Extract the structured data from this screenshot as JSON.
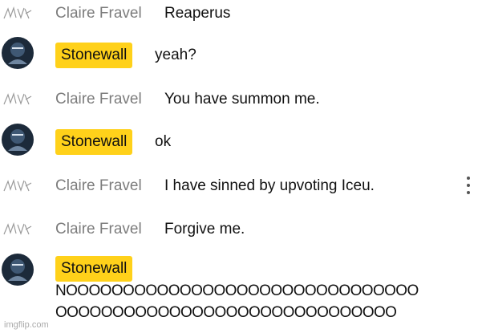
{
  "chat": {
    "messages": [
      {
        "author": "Claire Fravel",
        "text": "Reaperus"
      },
      {
        "author": "Stonewall",
        "text": "yeah?"
      },
      {
        "author": "Claire Fravel",
        "text": "You have summon me."
      },
      {
        "author": "Stonewall",
        "text": "ok"
      },
      {
        "author": "Claire Fravel",
        "text": "I have sinned by upvoting Iceu."
      },
      {
        "author": "Claire Fravel",
        "text": "Forgive me."
      },
      {
        "author": "Stonewall",
        "text_line1": "NOOOOOOOOOOOOOOOOOOOOOOOOOOOOOOO",
        "text_line2": "OOOOOOOOOOOOOOOOOOOOOOOOOOOOOO"
      }
    ]
  },
  "watermark": "imgflip.com",
  "colors": {
    "badge": "#ffd11a",
    "author_gray": "#7c7c7c",
    "avatar_dark": "#1c2a3a"
  },
  "icons": {
    "claire_avatar": "scribble-avatar-icon",
    "stonewall_avatar": "dark-round-avatar-icon",
    "menu": "kebab-menu-icon"
  }
}
